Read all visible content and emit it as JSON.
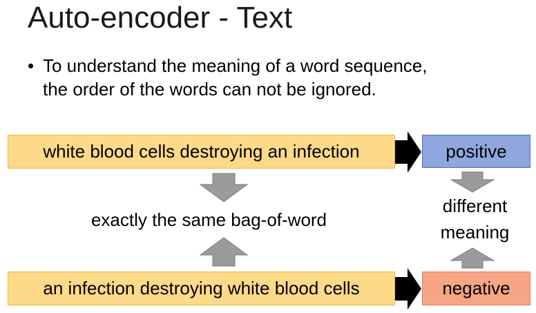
{
  "slide": {
    "title": "Auto-encoder - Text",
    "bullet": {
      "symbol": "•",
      "line1": "To understand the meaning of a word sequence,",
      "line2": "the order of the words can not be ignored."
    }
  },
  "diagram": {
    "sentence_top": "white blood cells destroying an infection",
    "sentence_bottom": "an infection destroying white blood cells",
    "result_top": "positive",
    "result_bottom": "negative",
    "middle_label": "exactly the same bag-of-word",
    "right_label_line1": "different",
    "right_label_line2": "meaning",
    "colors": {
      "sentence_fill": "#fdd98a",
      "positive_fill": "#8fa6df",
      "negative_fill": "#f6a585",
      "gray_arrow": "#9b9b9b",
      "black_arrow": "#000000"
    }
  }
}
